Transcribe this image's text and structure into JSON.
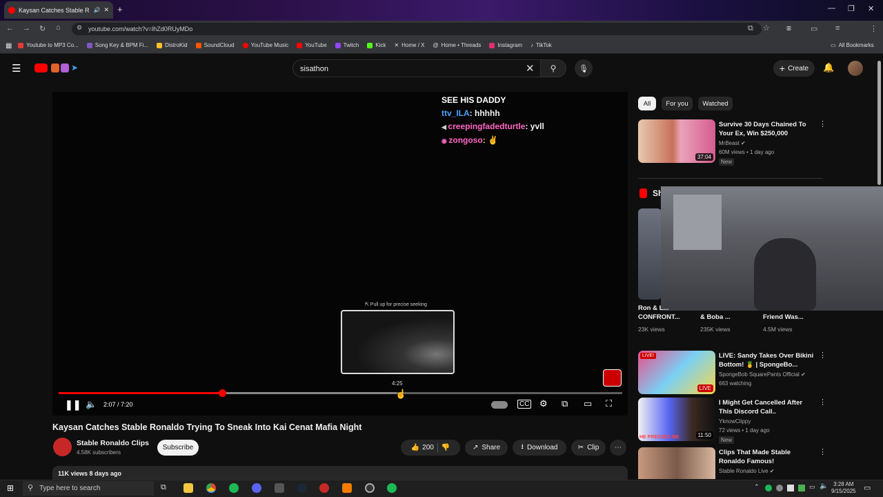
{
  "browser": {
    "tab_title": "Kaysan Catches Stable Ron…",
    "url": "youtube.com/watch?v=lhZd0RUyMDo",
    "bookmarks": [
      {
        "label": "Youtube to MP3 Co...",
        "color": "#e53935"
      },
      {
        "label": "Song Key & BPM Fi...",
        "color": "#7e57c2"
      },
      {
        "label": "DistroKid",
        "color": "#fbc02d"
      },
      {
        "label": "SoundCloud",
        "color": "#ff5500"
      },
      {
        "label": "YouTube Music",
        "color": "#ff0000"
      },
      {
        "label": "YouTube",
        "color": "#ff0000"
      },
      {
        "label": "Twitch",
        "color": "#9146ff"
      },
      {
        "label": "Kick",
        "color": "#53fc18"
      },
      {
        "label": "Home / X",
        "color": "#ffffff"
      },
      {
        "label": "Home • Threads",
        "color": "#ffffff"
      },
      {
        "label": "Instagram",
        "color": "#e1306c"
      },
      {
        "label": "TikTok",
        "color": "#ffffff"
      }
    ],
    "all_bookmarks": "All Bookmarks"
  },
  "youtube": {
    "search_value": "sisathon",
    "create_label": "Create",
    "chat": [
      {
        "user": "",
        "text": "SEE HIS DADDY",
        "color": "#ffffff"
      },
      {
        "user": "ttv_ILA",
        "text": ": hhhhh",
        "color": "#4aa3ff"
      },
      {
        "user": "creepingfadedturtle",
        "text": ": yvll",
        "color": "#ff66c4"
      },
      {
        "user": "zongoso",
        "text": ": ✌",
        "color": "#ff66c4"
      }
    ],
    "seek_hint": "⇱ Pull up for precise seeking",
    "preview_time": "4:25",
    "progress_fraction": 0.29,
    "buffer_fraction": 0.6,
    "time_display": "2:07 / 7:20",
    "video_title": "Kaysan Catches Stable Ronaldo Trying To Sneak Into Kai Cenat Mafia Night",
    "channel_name": "Stable Ronaldo Clips",
    "subscribers": "4.58K subscribers",
    "subscribe_label": "Subscribe",
    "likes": "200",
    "share_label": "Share",
    "download_label": "Download",
    "clip_label": "Clip",
    "views_line": "11K views  8 days ago",
    "chips": [
      "All",
      "For you",
      "Watched"
    ],
    "recommendations": [
      {
        "title": "Survive 30 Days Chained To Your Ex, Win $250,000",
        "channel": "MrBeast",
        "meta": "60M views • 1 day ago",
        "badge": "New",
        "duration": "37:04"
      },
      {
        "title": "LIVE: Sandy Takes Over Bikini Bottom! 🍍 | SpongeBo...",
        "channel": "SpongeBob SquarePants Official",
        "meta": "663 watching",
        "badge": "",
        "duration": "LIVE"
      },
      {
        "title": "I Might Get Cancelled After This Discord Call..",
        "channel": "YknowClippy",
        "meta": "72 views • 1 day ago",
        "badge": "New",
        "duration": "11:50"
      },
      {
        "title": "Clips That Made Stable Ronaldo Famous!",
        "channel": "Stable Ronaldo Live",
        "meta": "",
        "badge": "",
        "duration": ""
      }
    ],
    "shorts_label": "Sh",
    "shorts": [
      {
        "title": "Ron & L... CONFRONT...",
        "views": "23K views"
      },
      {
        "title": "& Boba ...",
        "views": "235K views"
      },
      {
        "title": "Friend Was...",
        "views": "4.5M views"
      }
    ]
  },
  "taskbar": {
    "search_placeholder": "Type here to search",
    "time": "3:28 AM",
    "date": "9/15/2025"
  }
}
